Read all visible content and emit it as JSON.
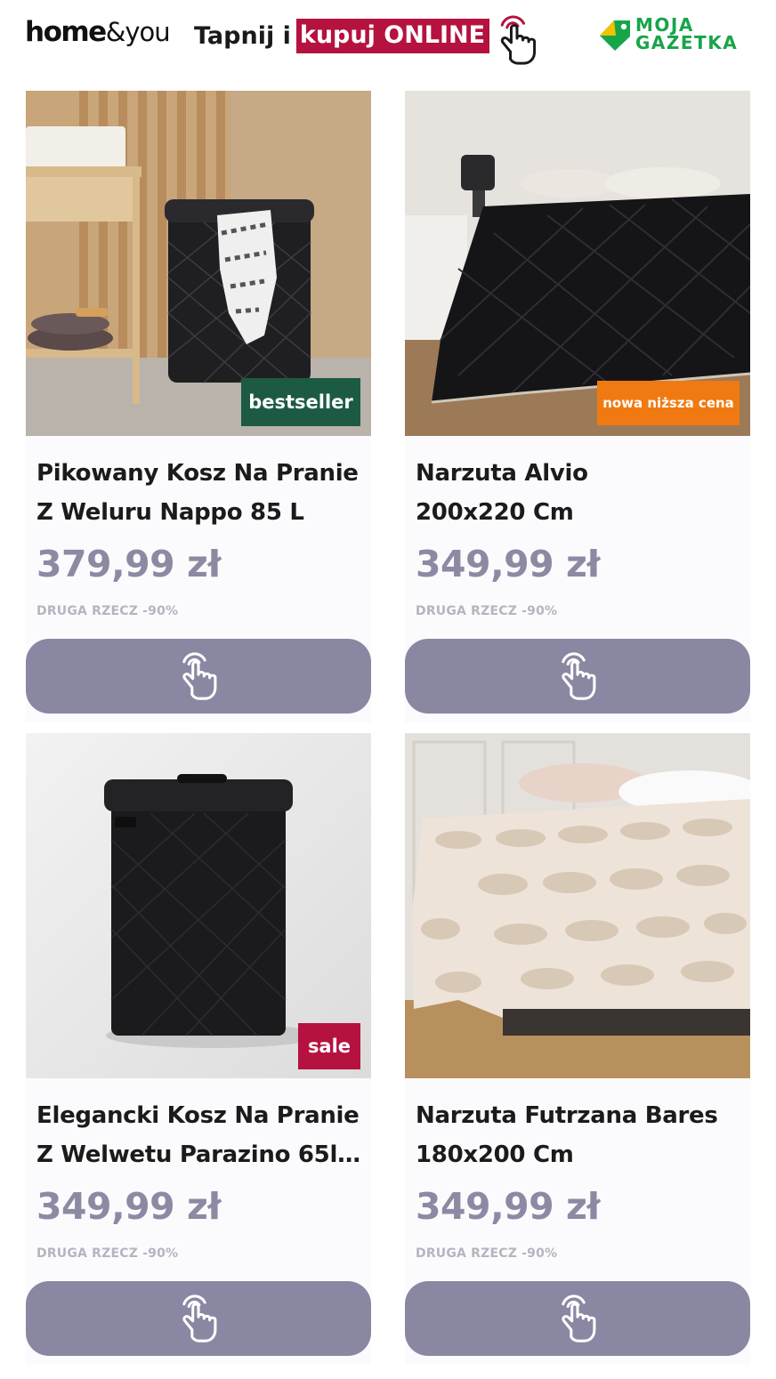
{
  "header": {
    "brand": {
      "part1": "home",
      "part2": "&you"
    },
    "tagline": {
      "plain": "Tapnij i",
      "highlight": "kupuj ONLINE"
    },
    "partner_logo": {
      "line1": "MOJA",
      "line2": "GAZETKA"
    }
  },
  "colors": {
    "accent_red": "#b5123f",
    "button": "#8a87a2",
    "price": "#8c8aa3",
    "bestseller_badge": "#1c5a44",
    "lower_price_badge": "#f07a11",
    "partner_green": "#17a54a"
  },
  "products": [
    {
      "title_line1": "Pikowany Kosz Na Pranie",
      "title_line2": "Z Weluru Nappo 85 L",
      "price": "379,99 zł",
      "promo": "DRUGA RZECZ -90%",
      "badge": "bestseller",
      "button_icon": "tap-hand-icon"
    },
    {
      "title_line1": "Narzuta Alvio",
      "title_line2": "200x220 Cm",
      "price": "349,99 zł",
      "promo": "DRUGA RZECZ -90%",
      "badge": "nowa niższa cena",
      "button_icon": "tap-hand-icon"
    },
    {
      "title_line1": "Elegancki Kosz Na Pranie",
      "title_line2": "Z Welwetu Parazino 65l ...",
      "price": "349,99 zł",
      "promo": "DRUGA RZECZ -90%",
      "badge": "sale",
      "button_icon": "tap-hand-icon"
    },
    {
      "title_line1": "Narzuta Futrzana Bares",
      "title_line2": "180x200 Cm",
      "price": "349,99 zł",
      "promo": "DRUGA RZECZ -90%",
      "badge": "",
      "button_icon": "tap-hand-icon"
    }
  ]
}
